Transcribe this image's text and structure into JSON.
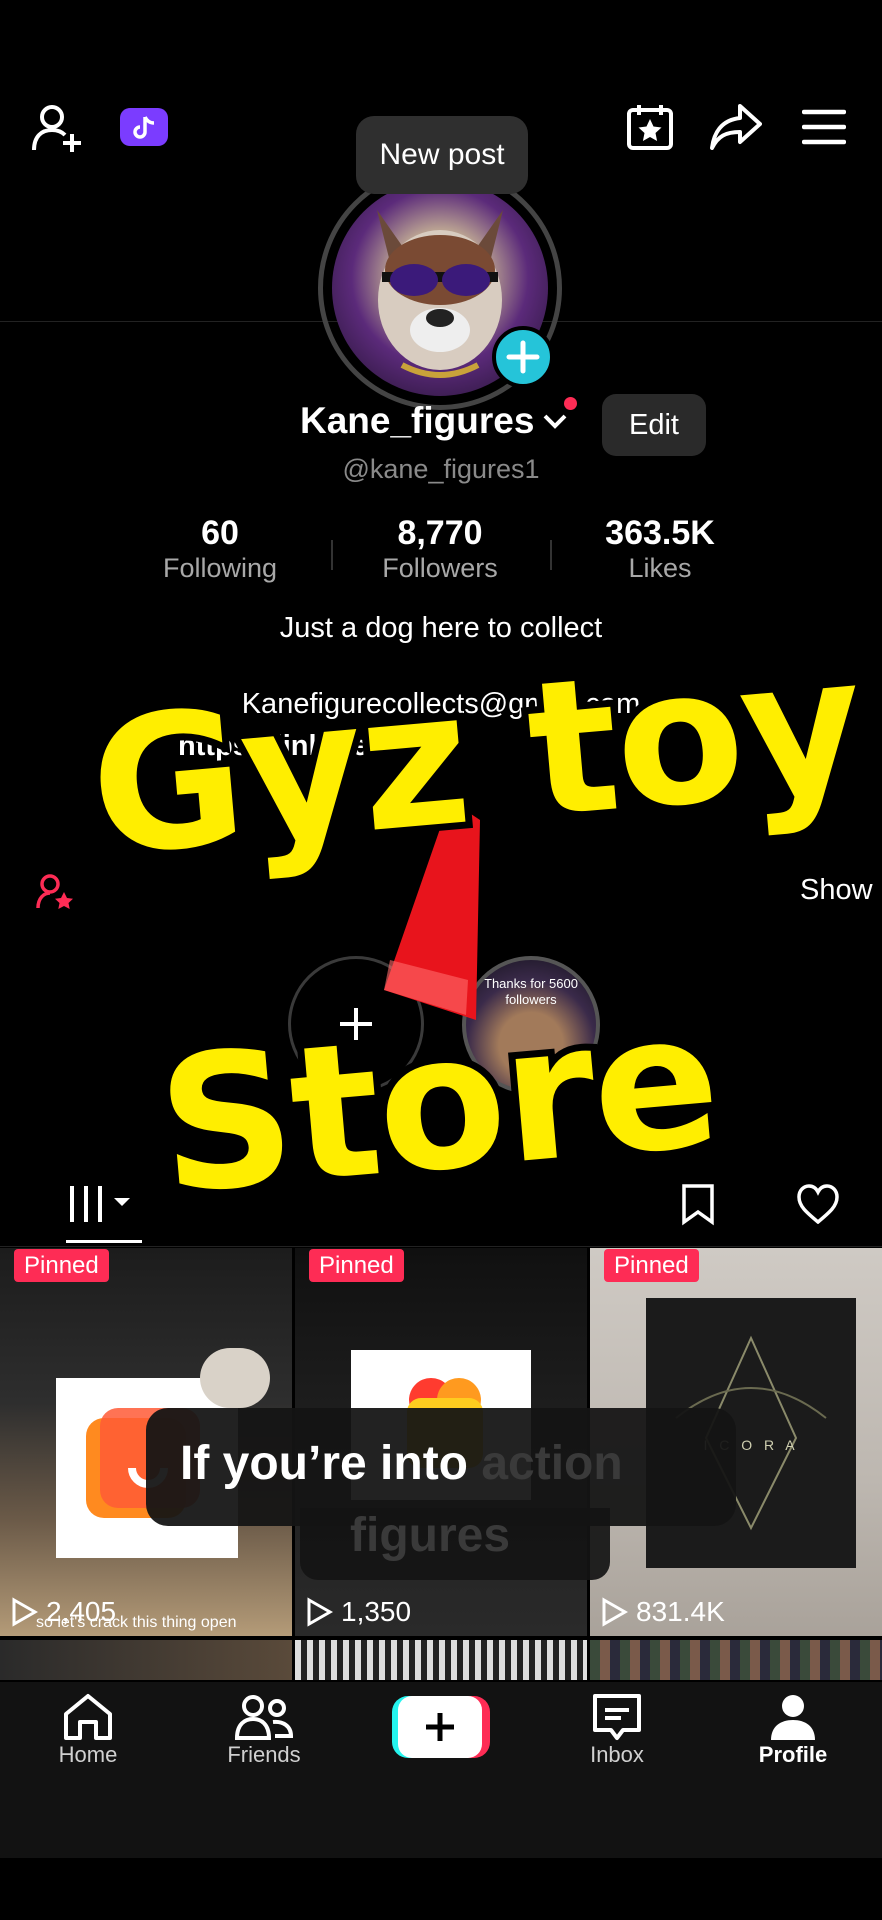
{
  "header": {
    "new_post_tooltip": "New post"
  },
  "profile": {
    "display_name": "Kane_figures",
    "handle": "@kane_figures1",
    "edit_label": "Edit",
    "bio": "Just a dog here to collect",
    "email": "Kanefigurecollects@gmail.com",
    "link": "https://linktr.ee/k",
    "show_label": "Show"
  },
  "stats": {
    "following_value": "60",
    "following_label": "Following",
    "followers_value": "8,770",
    "followers_label": "Followers",
    "likes_value": "363.5K",
    "likes_label": "Likes"
  },
  "highlights": {
    "story_caption": "Thanks for 5600 followers"
  },
  "videos": [
    {
      "pinned": "Pinned",
      "views": "2,405",
      "caption": "so let's crack this thing open"
    },
    {
      "pinned": "Pinned",
      "views": "1,350",
      "caption": ""
    },
    {
      "pinned": "Pinned",
      "views": "831.4K",
      "caption": ""
    }
  ],
  "overlay": {
    "line1": "Gyz toy",
    "line2": "Store",
    "subtitle_visible": "If you’re into",
    "subtitle_faded_1": "action",
    "subtitle_faded_2": "figures"
  },
  "bottom_nav": [
    {
      "label": "Home",
      "icon": "home-icon"
    },
    {
      "label": "Friends",
      "icon": "friends-icon"
    },
    {
      "label": "",
      "icon": "create-icon"
    },
    {
      "label": "Inbox",
      "icon": "inbox-icon"
    },
    {
      "label": "Profile",
      "icon": "profile-icon"
    }
  ],
  "colors": {
    "accent_pink": "#fe2c55",
    "accent_cyan": "#25c4d9",
    "overlay_yellow": "#ffee00",
    "studio_purple": "#7b3cff"
  }
}
